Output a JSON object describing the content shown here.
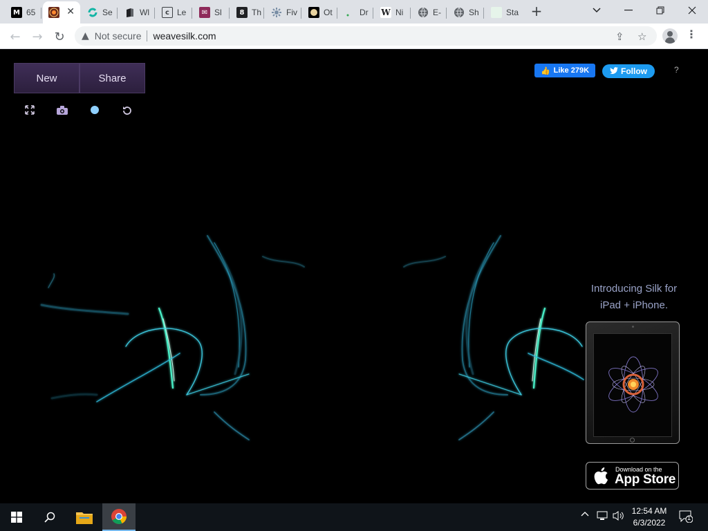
{
  "browser": {
    "tabs": [
      {
        "label": "65",
        "icon": "medium-icon",
        "color": "#000000"
      },
      {
        "label": "",
        "icon": "silk-icon",
        "color": "#6b2a1a",
        "active": true
      },
      {
        "label": "Se",
        "icon": "refresh-logo-icon",
        "color": "#12b5a5"
      },
      {
        "label": "Wl",
        "icon": "book-icon",
        "color": "#202124"
      },
      {
        "label": "Le",
        "icon": "letter-c-icon",
        "color": "#3c4043"
      },
      {
        "label": "Sl",
        "icon": "ticket-icon",
        "color": "#8e2a5a"
      },
      {
        "label": "Th",
        "icon": "theme-icon",
        "color": "#202124"
      },
      {
        "label": "Fiv",
        "icon": "gear-flower-icon",
        "color": "#5f6368"
      },
      {
        "label": "Ot",
        "icon": "planet-icon",
        "color": "#b08d57"
      },
      {
        "label": "Dr",
        "icon": "dot-icon",
        "color": "#34a853"
      },
      {
        "label": "Ni",
        "icon": "wikipedia-icon",
        "color": "#202124"
      },
      {
        "label": "E-",
        "icon": "globe-icon",
        "color": "#5f6368"
      },
      {
        "label": "Sh",
        "icon": "globe-icon",
        "color": "#5f6368"
      },
      {
        "label": "Sta",
        "icon": "blank-page-icon",
        "color": "#e6f4ea"
      }
    ],
    "security_label": "Not secure",
    "url": "weavesilk.com"
  },
  "page": {
    "new_label": "New",
    "share_label": "Share",
    "fb_like_label": "Like 279K",
    "twitter_follow_label": "Follow",
    "help_label": "?",
    "promo_line1": "Introducing Silk for",
    "promo_line2": "iPad + iPhone.",
    "appstore_small": "Download on the",
    "appstore_big": "App Store",
    "accent_color": "#3f2e57",
    "silk_color": "#3fd2e8"
  },
  "taskbar": {
    "time": "12:54 AM",
    "date": "6/3/2022",
    "notification_count": "1"
  }
}
